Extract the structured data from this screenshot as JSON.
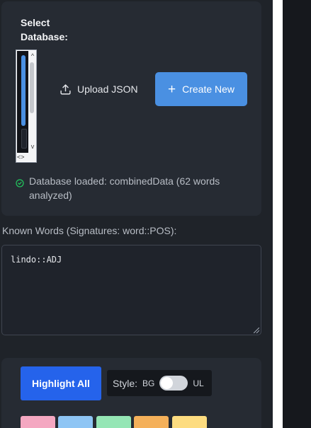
{
  "database": {
    "select_label": "Select Database:",
    "hscroll_glyph": "<>",
    "scroll_up_glyph": "^",
    "scroll_down_glyph": "v",
    "upload_label": "Upload JSON",
    "create_label": "Create New",
    "create_icon": "+",
    "status_text": "Database loaded: combinedData (62 words analyzed)"
  },
  "known_words": {
    "label": "Known Words (Signatures: word::POS):",
    "value": "lindo::ADJ"
  },
  "highlight": {
    "button_label": "Highlight All",
    "style_label": "Style:",
    "bg_label": "BG",
    "ul_label": "UL",
    "toggle_on": false
  },
  "swatches": [
    "#f4a7c1",
    "#8ec5f4",
    "#95e6b5",
    "#f4b05a",
    "#fddc80"
  ],
  "colors": {
    "accent_blue": "#4a90e2",
    "highlight_blue": "#2563eb",
    "status_green": "#22c55e"
  }
}
